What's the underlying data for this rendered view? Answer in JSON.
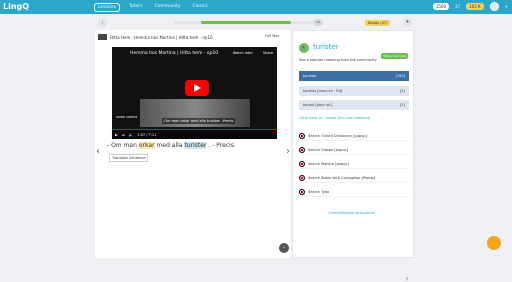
{
  "topbar": {
    "logo": "LingQ",
    "nav": [
      "Lessons",
      "Tutors",
      "Community",
      "Classic"
    ],
    "count1": "1500",
    "count2": "37",
    "coins": "102 K",
    "badge": "+"
  },
  "lesson": {
    "title": "Hitta Hem · Hemma hos Martina | Hitta hem - ep10",
    "full_text": "Full Text",
    "progress_number": "16",
    "lang_badge": "Badge (47)",
    "video_title": "Hemma hos Martina | Hitta hem - ep10",
    "video_icons": [
      "Watch later",
      "Share"
    ],
    "more_videos": "MORE VIDEOS",
    "subtitle": "-Om man orkar med alla turister. -Precis.",
    "time": "1:07 / 7:11",
    "sentence": {
      "before": "- Om man",
      "yellow": "orkar",
      "middle": "med alla",
      "blue": "turister",
      "after": ". - Precis."
    },
    "translate": "Translate Sentence"
  },
  "side": {
    "word": "turister",
    "popular": "See a popular meaning from the community",
    "show_me": "Show me more",
    "meanings": [
      {
        "text": "tourists",
        "count": "[190]"
      },
      {
        "text": "tourists [noun·en · Ed]",
        "count": "[1]"
      },
      {
        "text": "tourist [noun·pl.]",
        "count": "[1]"
      }
    ],
    "view_more": "View more   Or, create your own meaning",
    "dictionaries": [
      "Search Oxford Dictionary [popup]",
      "Search Glosbe [popup]",
      "Search Majstro [popup]",
      "Search Babla Verb Conjugator [Popup]",
      "Search Tyda"
    ],
    "check": "Check/Manage dictionaries",
    "help": "?"
  },
  "colors": {
    "topbar": "#2aa7c9",
    "green": "#6bc04b",
    "blue": "#3b6ea5"
  },
  "progress": {
    "fraction": 0.8
  }
}
